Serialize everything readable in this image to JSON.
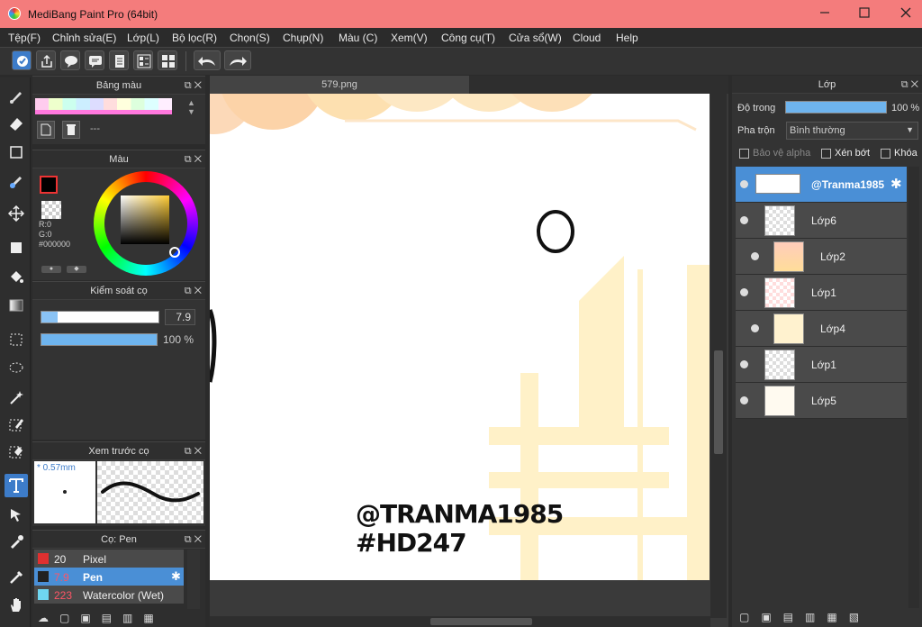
{
  "window": {
    "title": "MediBang Paint Pro (64bit)"
  },
  "menu": [
    "Tệp(F)",
    "Chỉnh sửa(E)",
    "Lớp(L)",
    "Bộ lọc(R)",
    "Chọn(S)",
    "Chụp(N)",
    "Màu (C)",
    "Xem(V)",
    "Công cụ(T)",
    "Cửa sổ(W)",
    "Cloud",
    "Help"
  ],
  "palette_panel": {
    "title": "Bảng màu",
    "name": "---"
  },
  "color_panel": {
    "title": "Màu",
    "r": "R:0",
    "g": "G:0",
    "hex": "#000000"
  },
  "brush_control": {
    "title": "Kiểm soát cọ",
    "size": "7.9",
    "opacity": "100 %"
  },
  "brush_preview": {
    "title": "Xem trước cọ",
    "size_label": "* 0.57mm"
  },
  "brush_list": {
    "title": "Cọ: Pen",
    "items": [
      {
        "size": "20",
        "name": "Pixel",
        "color": "#e03030"
      },
      {
        "size": "7.9",
        "name": "Pen",
        "color": "#222222"
      },
      {
        "size": "223",
        "name": "Watercolor (Wet)",
        "color": "#6fd6f0"
      }
    ]
  },
  "canvas": {
    "tab_name": "579.png",
    "watermark_line1": "@TRANMA1985",
    "watermark_line2": "#HD247"
  },
  "layer_panel": {
    "title": "Lớp",
    "opacity_label": "Độ trong",
    "opacity_value": "100 %",
    "blend_label": "Pha trộn",
    "blend_value": "Bình thường",
    "protect_alpha": "Bảo vệ alpha",
    "clipping": "Xén bớt",
    "lock": "Khóa",
    "layers": [
      {
        "name": "@Tranma1985",
        "selected": true,
        "indent": false
      },
      {
        "name": "Lớp6",
        "selected": false,
        "indent": false
      },
      {
        "name": "Lớp2",
        "selected": false,
        "indent": true
      },
      {
        "name": "Lớp1",
        "selected": false,
        "indent": false
      },
      {
        "name": "Lớp4",
        "selected": false,
        "indent": true
      },
      {
        "name": "Lớp1",
        "selected": false,
        "indent": false
      },
      {
        "name": "Lớp5",
        "selected": false,
        "indent": false
      }
    ]
  }
}
